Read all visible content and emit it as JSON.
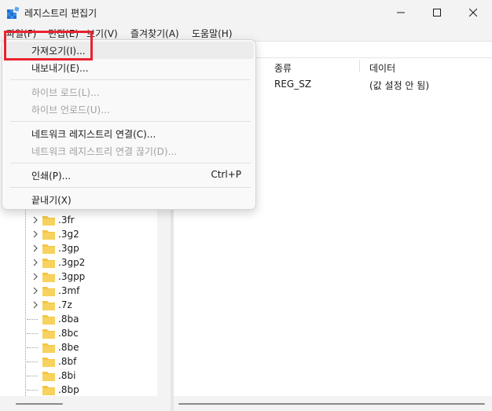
{
  "window": {
    "title": "레지스트리 편집기"
  },
  "menubar": {
    "items": [
      "파일(F)",
      "편집(E)",
      "보기(V)",
      "즐겨찾기(A)",
      "도움말(H)"
    ]
  },
  "file_menu": {
    "items": [
      {
        "label": "가져오기(I)...",
        "disabled": false,
        "shortcut": ""
      },
      {
        "label": "내보내기(E)...",
        "disabled": false,
        "shortcut": ""
      },
      {
        "label": "하이브 로드(L)...",
        "disabled": true,
        "shortcut": ""
      },
      {
        "label": "하이브 언로드(U)...",
        "disabled": true,
        "shortcut": ""
      },
      {
        "label": "네트워크 레지스트리 연결(C)...",
        "disabled": false,
        "shortcut": ""
      },
      {
        "label": "네트워크 레지스트리 연결 끊기(D)...",
        "disabled": true,
        "shortcut": ""
      },
      {
        "label": "인쇄(P)...",
        "disabled": false,
        "shortcut": "Ctrl+P"
      },
      {
        "label": "끝내기(X)",
        "disabled": false,
        "shortcut": ""
      }
    ]
  },
  "tree": {
    "items": [
      {
        "label": ".3fr",
        "expandable": true
      },
      {
        "label": ".3g2",
        "expandable": true
      },
      {
        "label": ".3gp",
        "expandable": true
      },
      {
        "label": ".3gp2",
        "expandable": true
      },
      {
        "label": ".3gpp",
        "expandable": true
      },
      {
        "label": ".3mf",
        "expandable": true
      },
      {
        "label": ".7z",
        "expandable": true
      },
      {
        "label": ".8ba",
        "expandable": false
      },
      {
        "label": ".8bc",
        "expandable": false
      },
      {
        "label": ".8be",
        "expandable": false
      },
      {
        "label": ".8bf",
        "expandable": false
      },
      {
        "label": ".8bi",
        "expandable": false
      },
      {
        "label": ".8bp",
        "expandable": false
      }
    ]
  },
  "values": {
    "columns": [
      "종류",
      "데이터"
    ],
    "rows": [
      {
        "type": "REG_SZ",
        "data": "(값 설정 안 됨)"
      }
    ]
  },
  "colors": {
    "highlight": "#e8232f",
    "folder": "#f4c542"
  }
}
